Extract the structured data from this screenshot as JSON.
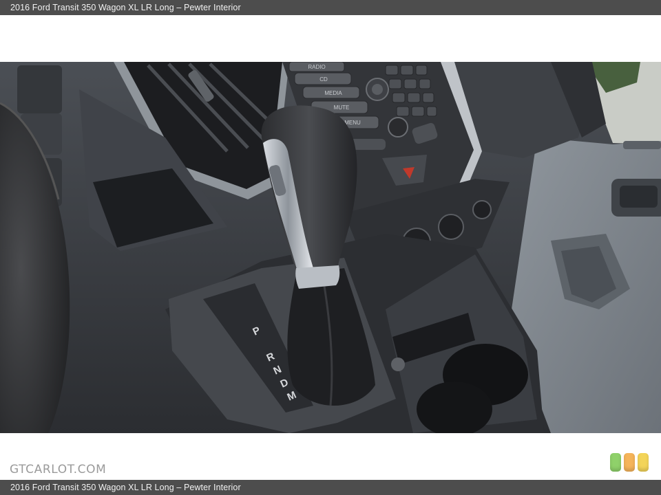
{
  "header": {
    "title": "2016 Ford Transit 350 Wagon XL LR Long – Pewter Interior"
  },
  "footer": {
    "caption": "2016 Ford Transit 350 Wagon XL LR Long – Pewter Interior"
  },
  "photo": {
    "radio_buttons": [
      "RADIO",
      "CD",
      "MEDIA",
      "MUTE",
      "MENU"
    ],
    "gear_letters": [
      "P",
      "R",
      "N",
      "D",
      "M"
    ]
  },
  "watermark": {
    "text": "GTCARLOT.COM"
  },
  "rating_badges": [
    {
      "name": "green",
      "color": "#8fd16a"
    },
    {
      "name": "orange",
      "color": "#f5b45a"
    },
    {
      "name": "yellow",
      "color": "#f3d459"
    }
  ]
}
